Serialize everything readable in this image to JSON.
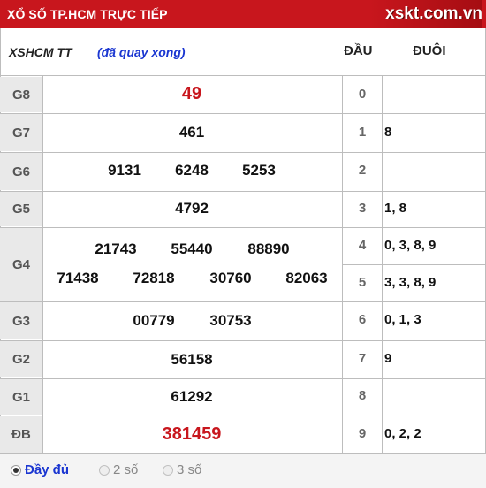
{
  "header": {
    "title": "XỔ SỐ TP.HCM TRỰC TIẾP",
    "logo": "xskt.com.vn"
  },
  "subhead": {
    "code": "XSHCM TT",
    "status": "(đã quay xong)",
    "dau_label": "ĐẦU",
    "duoi_label": "ĐUÔI"
  },
  "prizes": [
    {
      "label": "G8",
      "numbers": [
        "49"
      ]
    },
    {
      "label": "G7",
      "numbers": [
        "461"
      ]
    },
    {
      "label": "G6",
      "numbers": [
        "9131",
        "6248",
        "5253"
      ]
    },
    {
      "label": "G5",
      "numbers": [
        "4792"
      ]
    },
    {
      "label": "G4",
      "numbers": [
        "21743",
        "55440",
        "88890",
        "71438",
        "72818",
        "30760",
        "82063"
      ]
    },
    {
      "label": "G3",
      "numbers": [
        "00779",
        "30753"
      ]
    },
    {
      "label": "G2",
      "numbers": [
        "56158"
      ]
    },
    {
      "label": "G1",
      "numbers": [
        "61292"
      ]
    },
    {
      "label": "ĐB",
      "numbers": [
        "381459"
      ]
    }
  ],
  "loto": [
    {
      "head": "0",
      "tail": ""
    },
    {
      "head": "1",
      "tail": "8"
    },
    {
      "head": "2",
      "tail": ""
    },
    {
      "head": "3",
      "tail": "1, 8"
    },
    {
      "head": "4",
      "tail": "0, 3, 8, 9"
    },
    {
      "head": "5",
      "tail": "3, 3, 8, 9"
    },
    {
      "head": "6",
      "tail": "0, 1, 3"
    },
    {
      "head": "7",
      "tail": "9"
    },
    {
      "head": "8",
      "tail": ""
    },
    {
      "head": "9",
      "tail": "0, 2, 2"
    }
  ],
  "footer": {
    "options": [
      "Đầy đủ",
      "2 số",
      "3 số"
    ],
    "selected": "Đầy đủ"
  },
  "colors": {
    "brand_red": "#c8161d",
    "status_blue": "#1a36d1",
    "label_bg": "#e9e9e9"
  }
}
